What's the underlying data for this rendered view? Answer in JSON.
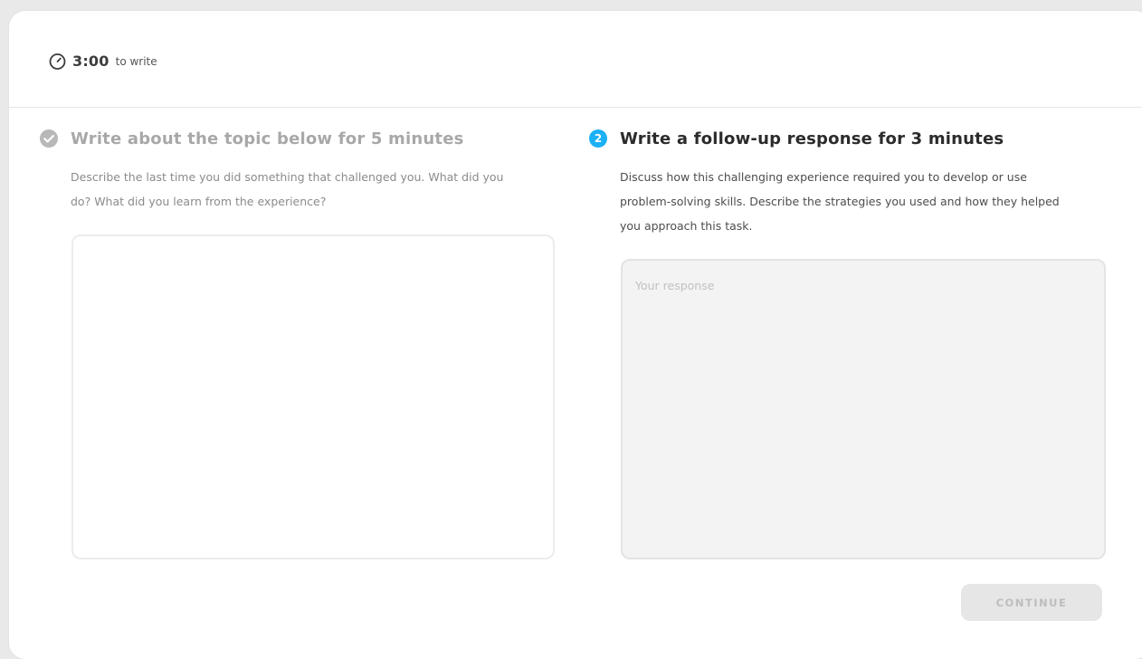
{
  "timer": {
    "time": "3:00",
    "suffix": "to write",
    "icon": "stopwatch-icon"
  },
  "step1": {
    "status": "completed",
    "icon": "check-circle-icon",
    "title": "Write about the topic below for 5 minutes",
    "prompt": "Describe the last time you did something that challenged you. What did you do? What did you learn from the experience?"
  },
  "step2": {
    "status": "active",
    "number": "2",
    "icon": "step-number-icon",
    "title": "Write a follow-up response for 3 minutes",
    "prompt": "Discuss how this challenging experience required you to develop or use problem-solving skills. Describe the strategies you used and how they helped you approach this task.",
    "response_value": "",
    "response_placeholder": "Your response"
  },
  "actions": {
    "continue_label": "CONTINUE"
  },
  "colors": {
    "accent": "#1cb0f6",
    "completed_icon": "#b8b8b8",
    "disabled_button_bg": "#e6e6e6",
    "disabled_button_text": "#bdbdbd"
  }
}
